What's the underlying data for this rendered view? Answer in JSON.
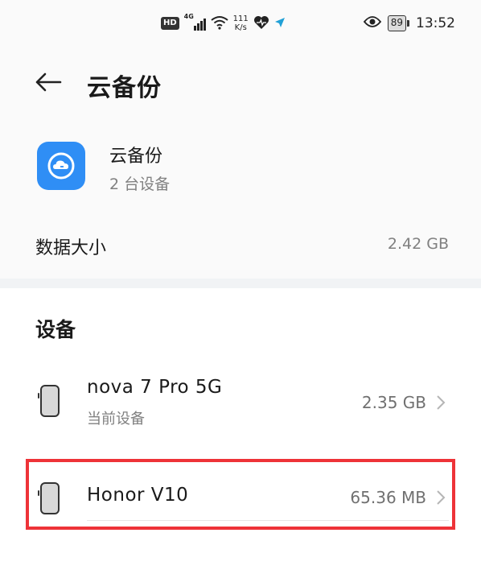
{
  "status_bar": {
    "hd": "HD",
    "network": "4G",
    "speed_value": "111",
    "speed_unit": "K/s",
    "battery": "89",
    "time": "13:52"
  },
  "header": {
    "title": "云备份"
  },
  "app": {
    "name": "云备份",
    "subtitle": "2 台设备",
    "data_label": "数据大小",
    "data_value": "2.42 GB"
  },
  "devices": {
    "section_title": "设备",
    "items": [
      {
        "name": "nova 7 Pro 5G",
        "subtitle": "当前设备",
        "size": "2.35 GB"
      },
      {
        "name": "Honor V10",
        "size": "65.36 MB"
      }
    ]
  },
  "colors": {
    "accent": "#2f8ef5",
    "highlight": "#ee3338",
    "secondary_text": "#808080"
  }
}
